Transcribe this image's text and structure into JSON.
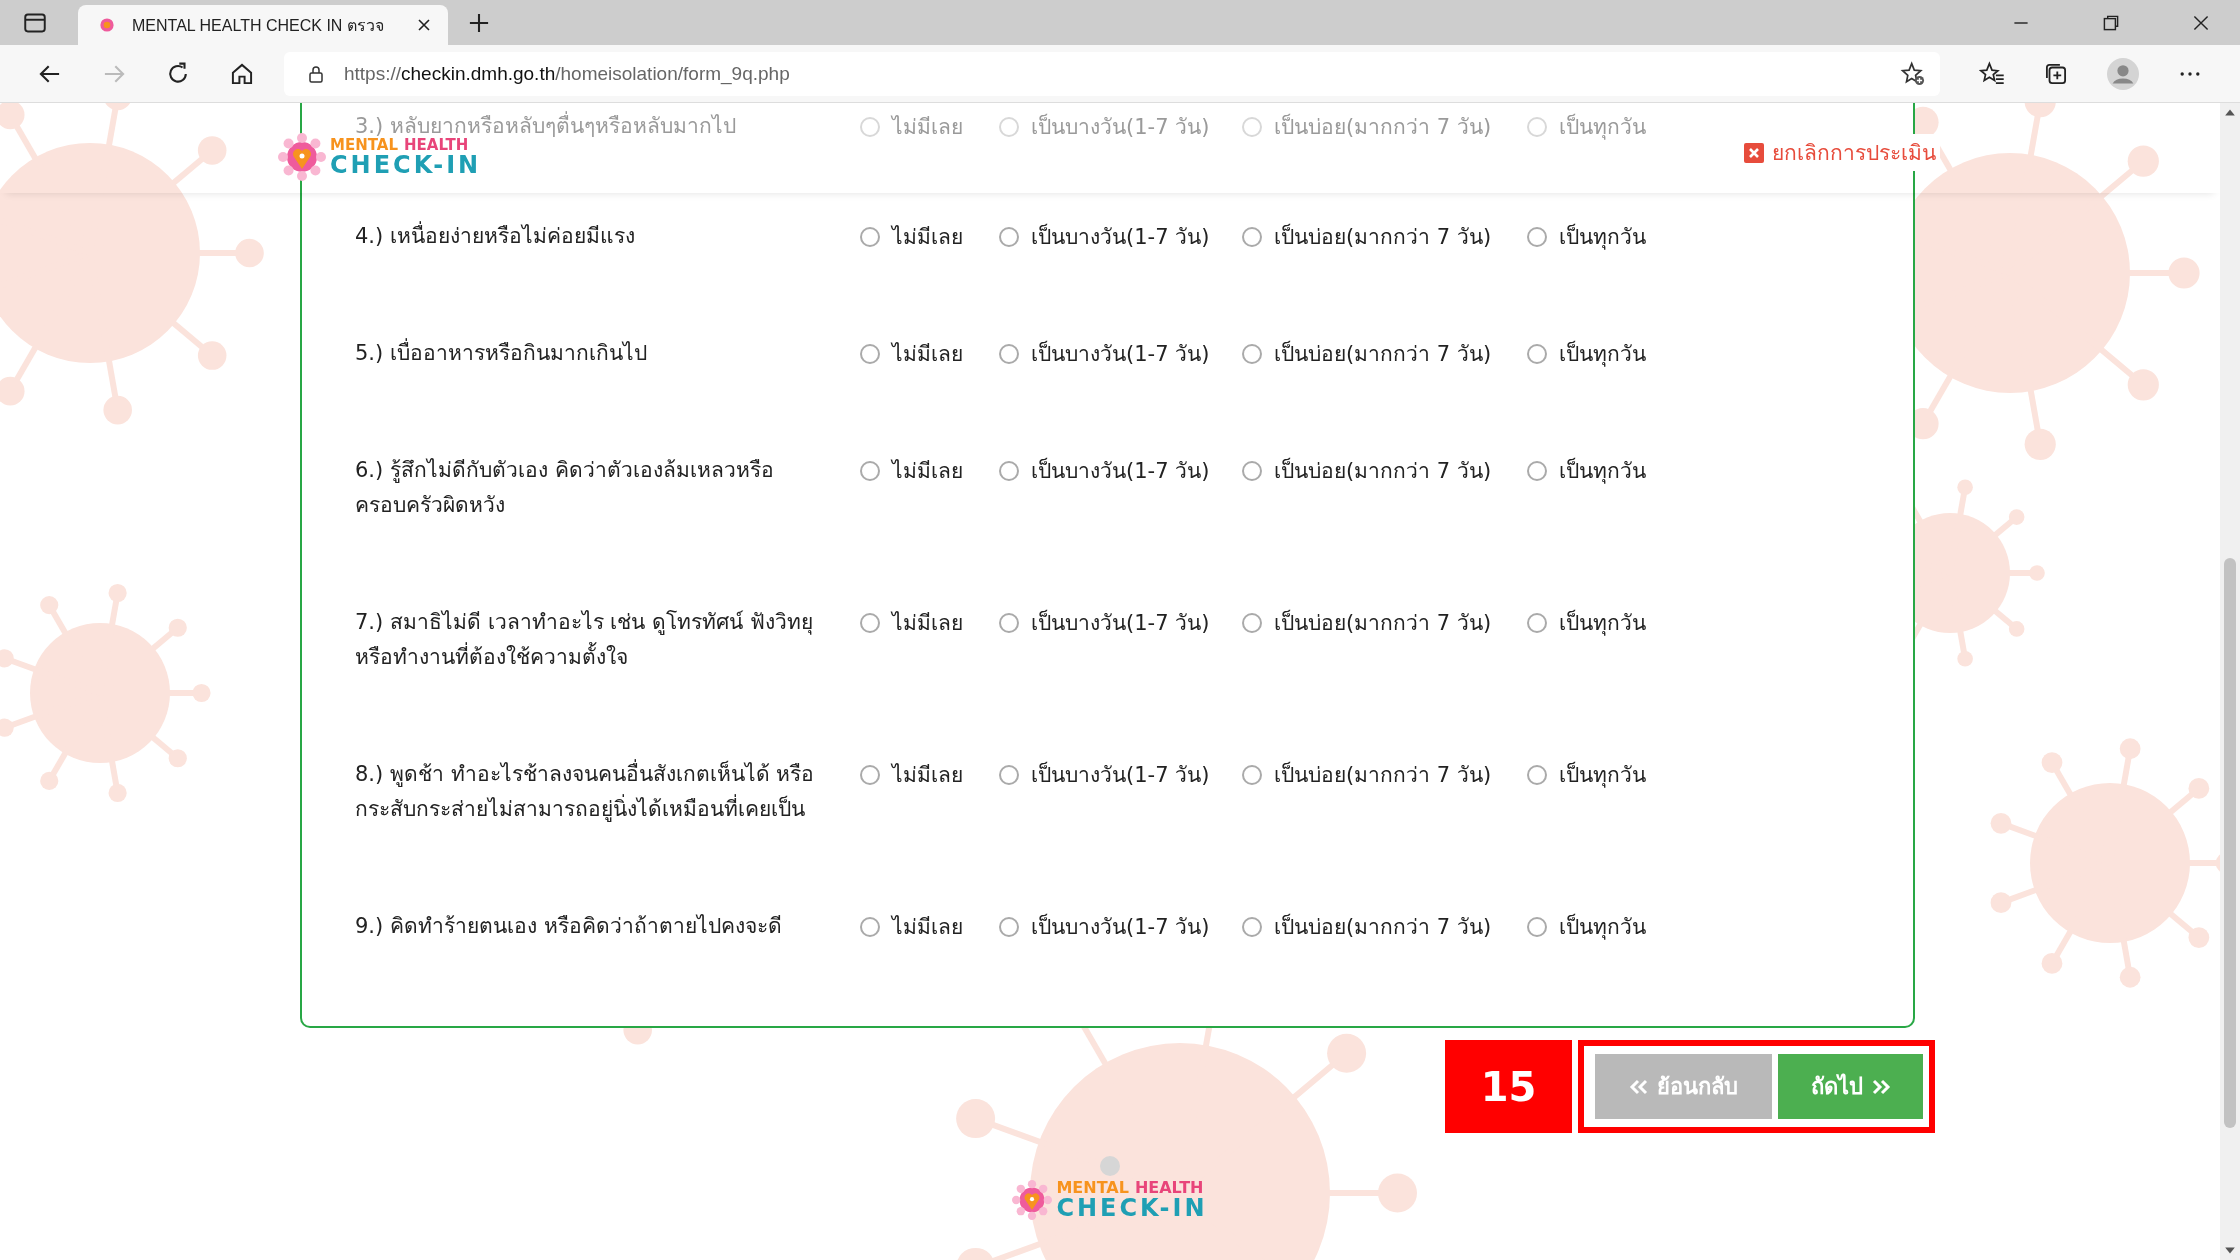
{
  "browser": {
    "tab_title": "MENTAL HEALTH CHECK IN ตรวจ",
    "url": {
      "scheme": "https://",
      "host": "checkin.dmh.go.th",
      "path": "/homeisolation/form_9q.php"
    },
    "forward_disabled": true
  },
  "header": {
    "logo": {
      "words": [
        "MENTAL",
        "HEALTH"
      ],
      "subtitle": "CHECK-IN"
    },
    "cancel": "ยกเลิกการประเมิน"
  },
  "questions": [
    {
      "text": "3.) หลับยากหรือหลับๆตื่นๆหรือหลับมากไป",
      "faded": true,
      "options": [
        {
          "label": "ไม่มีเลย",
          "selected": false
        },
        {
          "label": "เป็นบางวัน(1-7 วัน)",
          "selected": false
        },
        {
          "label": "เป็นบ่อย(มากกว่า 7 วัน)",
          "selected": false
        },
        {
          "label": "เป็นทุกวัน",
          "selected": false
        }
      ]
    },
    {
      "text": "4.) เหนื่อยง่ายหรือไม่ค่อยมีแรง",
      "faded": false,
      "options": [
        {
          "label": "ไม่มีเลย",
          "selected": false
        },
        {
          "label": "เป็นบางวัน(1-7 วัน)",
          "selected": false
        },
        {
          "label": "เป็นบ่อย(มากกว่า 7 วัน)",
          "selected": false
        },
        {
          "label": "เป็นทุกวัน",
          "selected": false
        }
      ]
    },
    {
      "text": "5.) เบื่ออาหารหรือกินมากเกินไป",
      "faded": false,
      "options": [
        {
          "label": "ไม่มีเลย",
          "selected": false
        },
        {
          "label": "เป็นบางวัน(1-7 วัน)",
          "selected": false
        },
        {
          "label": "เป็นบ่อย(มากกว่า 7 วัน)",
          "selected": false
        },
        {
          "label": "เป็นทุกวัน",
          "selected": false
        }
      ]
    },
    {
      "text": "6.) รู้สึกไม่ดีกับตัวเอง คิดว่าตัวเองล้มเหลวหรือครอบครัวผิดหวัง",
      "faded": false,
      "options": [
        {
          "label": "ไม่มีเลย",
          "selected": false
        },
        {
          "label": "เป็นบางวัน(1-7 วัน)",
          "selected": false
        },
        {
          "label": "เป็นบ่อย(มากกว่า 7 วัน)",
          "selected": false
        },
        {
          "label": "เป็นทุกวัน",
          "selected": false
        }
      ]
    },
    {
      "text": "7.) สมาธิไม่ดี เวลาทำอะไร เช่น ดูโทรทัศน์ ฟังวิทยุ หรือทำงานที่ต้องใช้ความตั้งใจ",
      "faded": false,
      "options": [
        {
          "label": "ไม่มีเลย",
          "selected": false
        },
        {
          "label": "เป็นบางวัน(1-7 วัน)",
          "selected": false
        },
        {
          "label": "เป็นบ่อย(มากกว่า 7 วัน)",
          "selected": false
        },
        {
          "label": "เป็นทุกวัน",
          "selected": false
        }
      ]
    },
    {
      "text": "8.) พูดช้า ทำอะไรช้าลงจนคนอื่นสังเกตเห็นได้ หรือกระสับกระส่ายไม่สามารถอยู่นิ่งได้เหมือนที่เคยเป็น",
      "faded": false,
      "options": [
        {
          "label": "ไม่มีเลย",
          "selected": false
        },
        {
          "label": "เป็นบางวัน(1-7 วัน)",
          "selected": false
        },
        {
          "label": "เป็นบ่อย(มากกว่า 7 วัน)",
          "selected": false
        },
        {
          "label": "เป็นทุกวัน",
          "selected": false
        }
      ]
    },
    {
      "text": "9.) คิดทำร้ายตนเอง หรือคิดว่าถ้าตายไปคงจะดี",
      "faded": false,
      "options": [
        {
          "label": "ไม่มีเลย",
          "selected": false
        },
        {
          "label": "เป็นบางวัน(1-7 วัน)",
          "selected": false
        },
        {
          "label": "เป็นบ่อย(มากกว่า 7 วัน)",
          "selected": false
        },
        {
          "label": "เป็นทุกวัน",
          "selected": false
        }
      ]
    }
  ],
  "step_badge": "15",
  "buttons": {
    "back": "ย้อนกลับ",
    "next": "ถัดไป"
  },
  "footer": {
    "logo": {
      "words": [
        "MENTAL",
        "HEALTH"
      ],
      "subtitle": "CHECK-IN"
    }
  }
}
